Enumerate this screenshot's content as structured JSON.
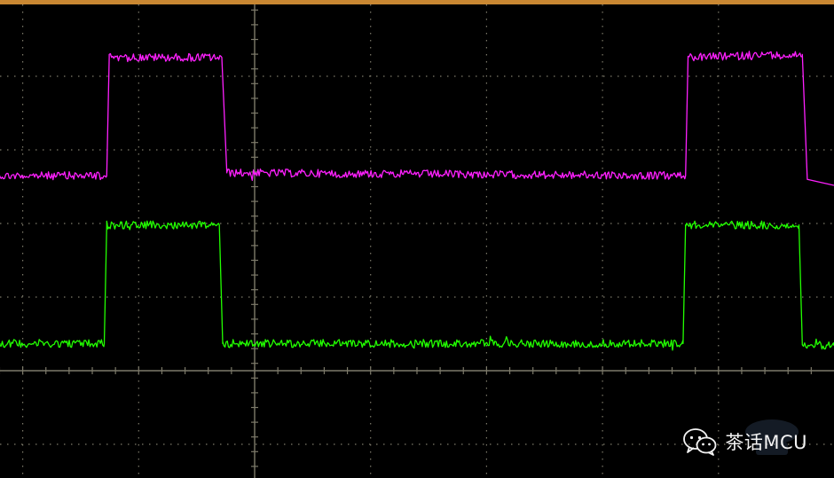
{
  "chart_data": {
    "type": "line",
    "title": "",
    "xlabel": "",
    "ylabel": "",
    "grid": true,
    "xlim": [
      0,
      10
    ],
    "ylim": [
      0,
      6.5
    ],
    "series": [
      {
        "color": "#ff20ff",
        "x": [
          0,
          1.28,
          1.31,
          2.66,
          2.72,
          8.22,
          8.25,
          9.62,
          9.68,
          10.0
        ],
        "y": [
          4.11,
          4.11,
          5.72,
          5.72,
          4.15,
          4.11,
          5.72,
          5.76,
          4.06,
          3.98
        ]
      },
      {
        "color": "#22ff00",
        "x": [
          0,
          1.25,
          1.28,
          2.63,
          2.67,
          8.19,
          8.22,
          9.58,
          9.62,
          10.0
        ],
        "y": [
          1.83,
          1.83,
          3.44,
          3.44,
          1.83,
          1.83,
          3.44,
          3.44,
          1.81,
          1.8
        ]
      }
    ]
  },
  "colors": {
    "background": "#000000",
    "grid": "#7d7a6a",
    "top_bar": "#c98732"
  },
  "watermark": {
    "text": "茶话MCU",
    "icon": "wechat-icon"
  }
}
